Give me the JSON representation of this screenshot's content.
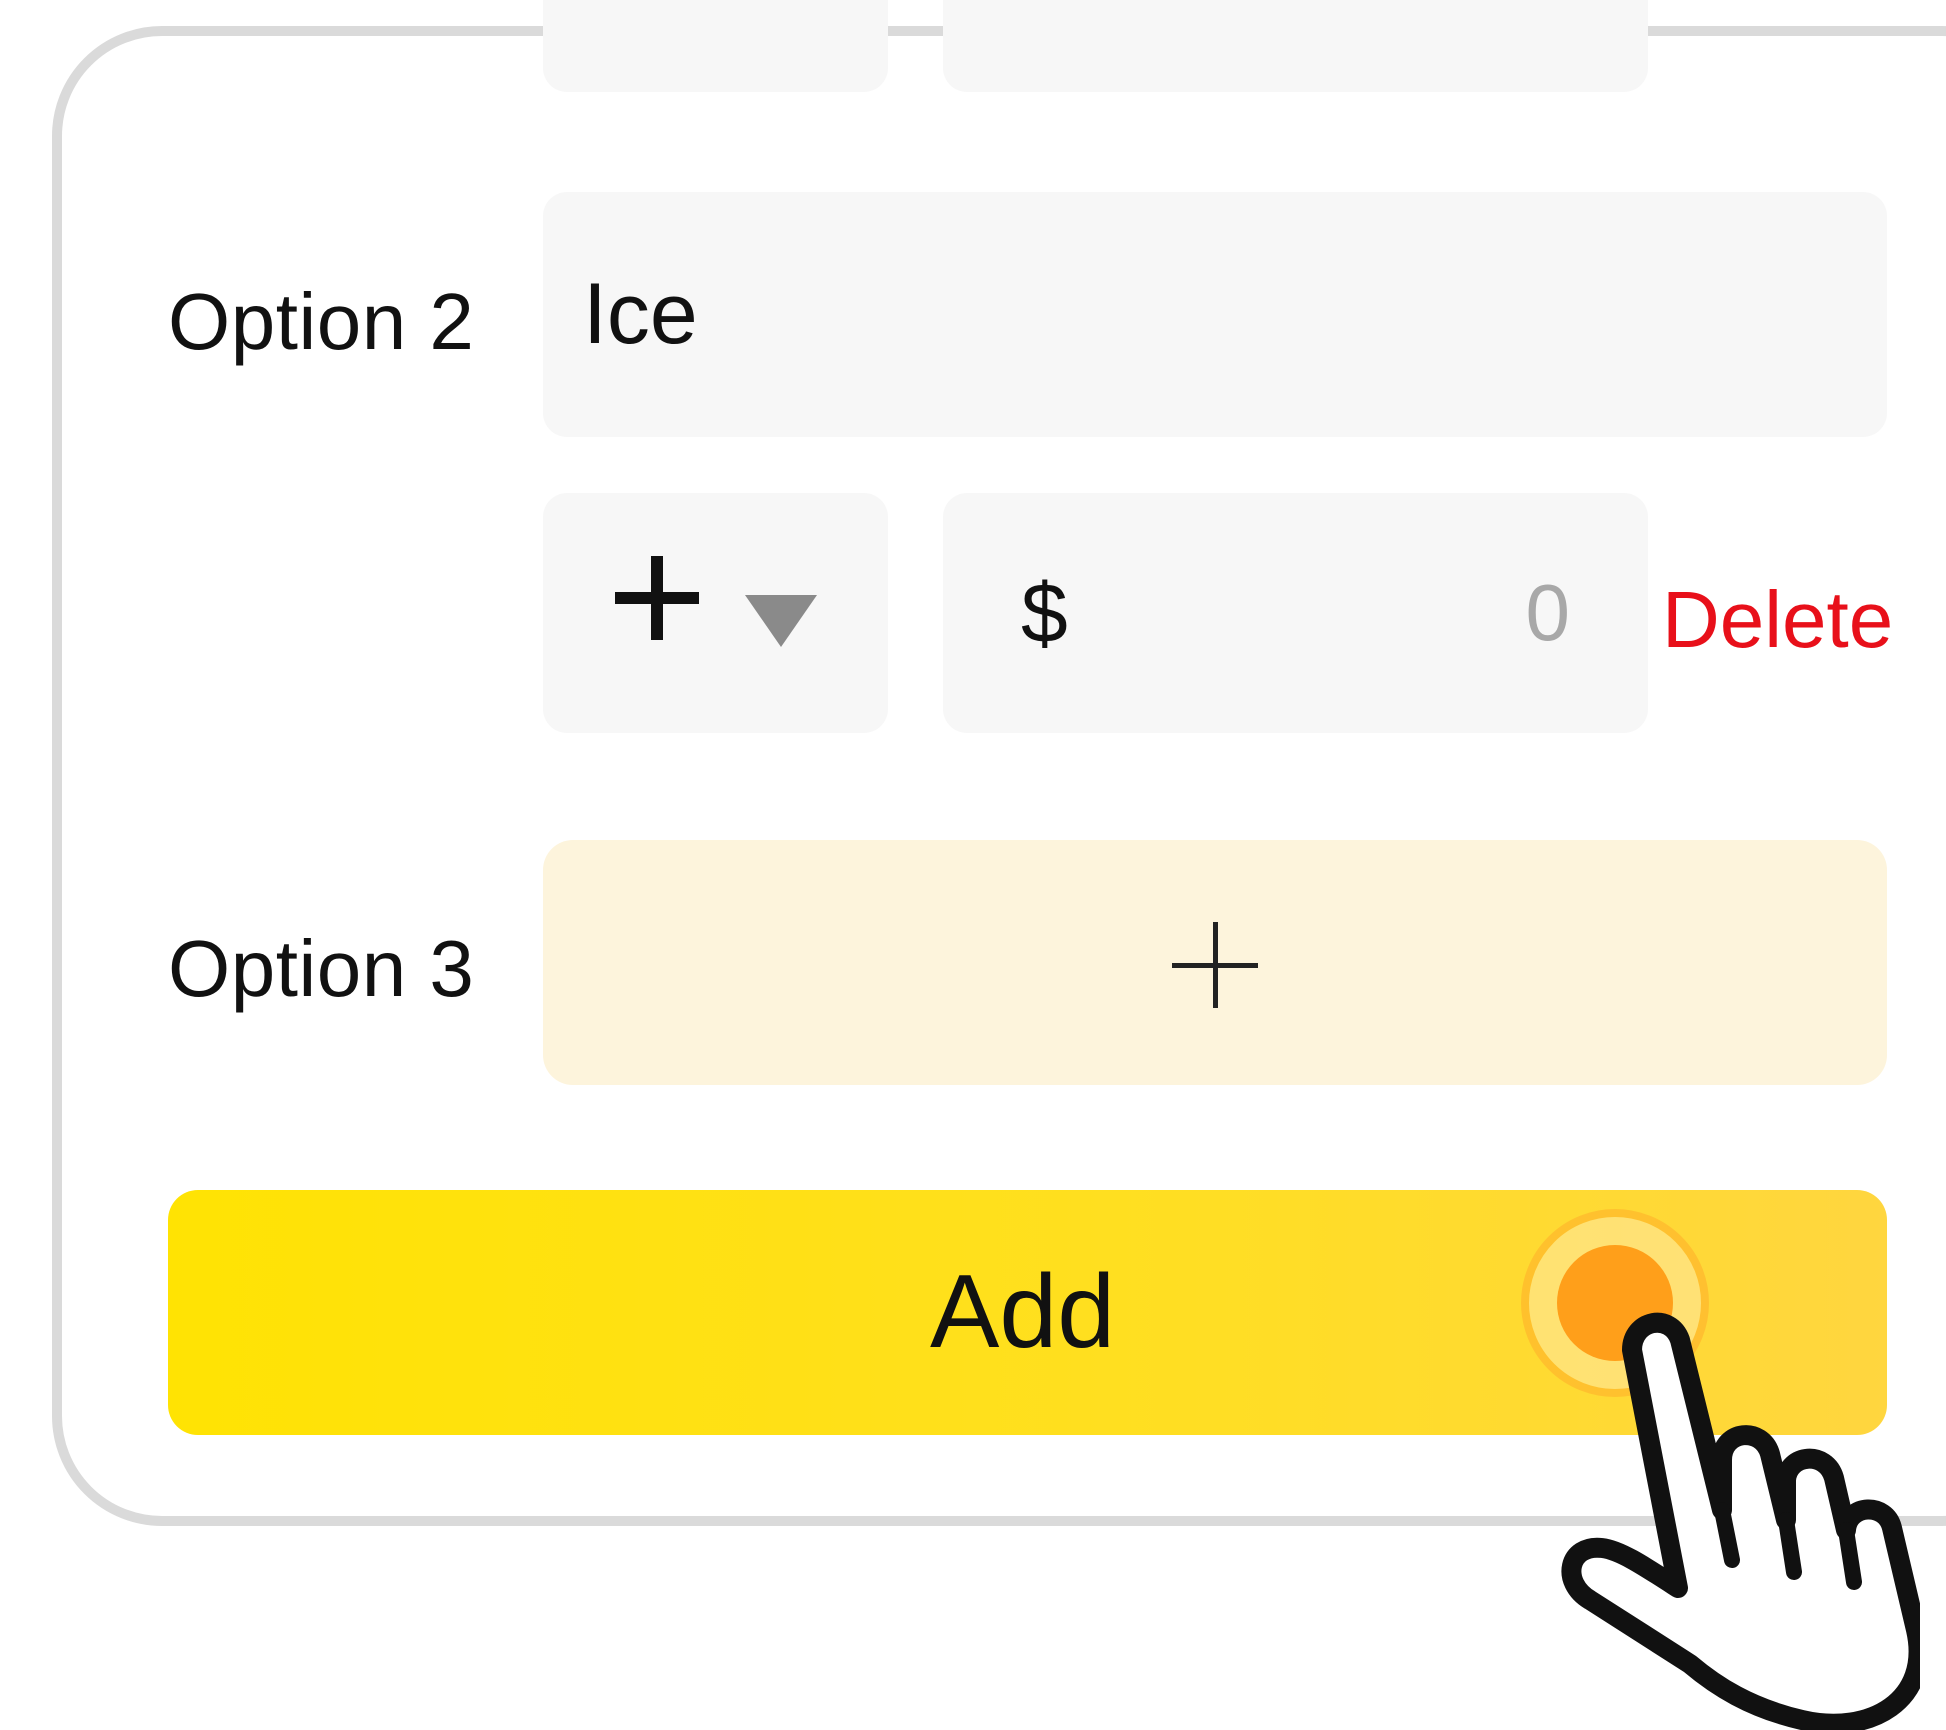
{
  "option2": {
    "label": "Option 2",
    "name_value": "Ice",
    "price_sign": "+",
    "currency_symbol": "$",
    "price_placeholder": "0",
    "delete_label": "Delete"
  },
  "option3": {
    "label": "Option 3",
    "add_icon": "plus-icon"
  },
  "add_button": {
    "label": "Add"
  },
  "colors": {
    "accent_yellow": "#ffe303",
    "add_option_bg": "#fdf4dc",
    "delete_red": "#e8101a",
    "tap_orange": "#ff9f1a"
  },
  "icons": {
    "dropdown": "caret-down-icon",
    "pointer": "pointing-hand-icon"
  }
}
